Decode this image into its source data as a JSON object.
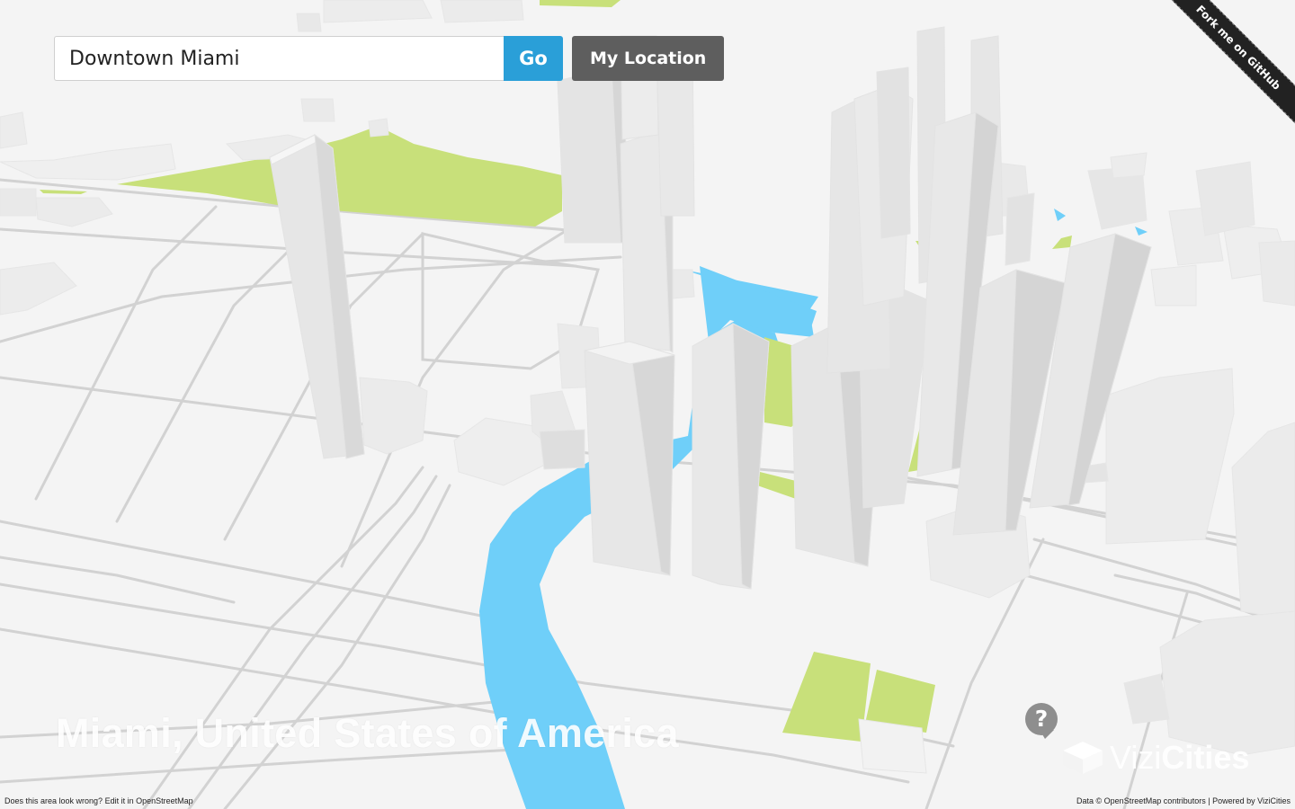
{
  "search": {
    "value": "Downtown Miami",
    "go_label": "Go",
    "location_label": "My Location"
  },
  "ribbon": {
    "label": "Fork me on GitHub"
  },
  "place": {
    "title": "Miami, United States of America"
  },
  "help": {
    "label": "?"
  },
  "logo": {
    "name_light": "Vizi",
    "name_bold": "Cities"
  },
  "footer": {
    "left_prefix": "Does this area look wrong?",
    "left_link": "Edit it in OpenStreetMap",
    "right_prefix": "Data ©",
    "right_link": "OpenStreetMap contributors",
    "right_sep": "|",
    "right_powered": "Powered by",
    "right_brand": "ViziCities"
  },
  "colors": {
    "background": "#f4f4f4",
    "road": "#cfcfcf",
    "water": "#6fcff9",
    "park": "#c8e07a",
    "building_light": "#f0f0f0",
    "building_mid": "#e4e4e4",
    "building_dark": "#d6d6d6",
    "go": "#2a9fd8",
    "location": "#5e5e5e"
  }
}
